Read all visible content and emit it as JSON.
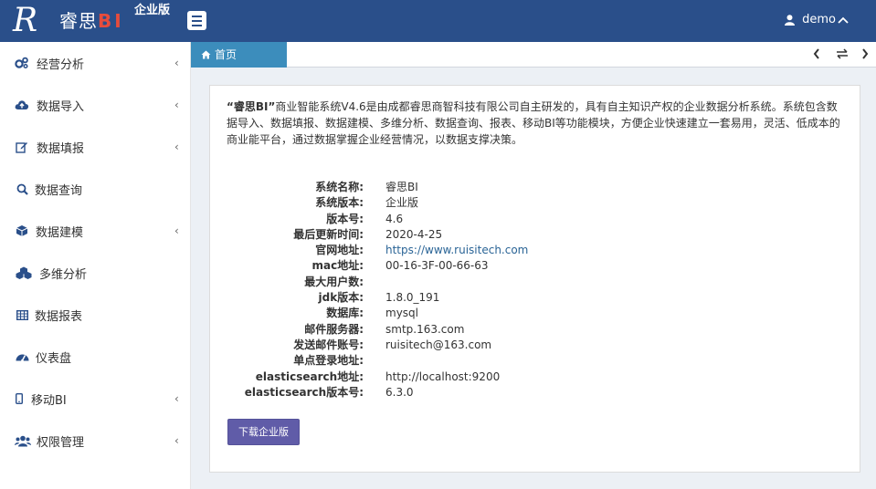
{
  "header": {
    "logo_letter": "R",
    "app_name": "睿思",
    "app_name_bi": "BI",
    "edition": "企业版",
    "user": "demo"
  },
  "sidebar": {
    "items": [
      {
        "label": "经营分析",
        "icon": "cogs-icon",
        "has_arrow": true
      },
      {
        "label": "数据导入",
        "icon": "cloud-upload-icon",
        "has_arrow": true
      },
      {
        "label": "数据填报",
        "icon": "edit-icon",
        "has_arrow": true
      },
      {
        "label": "数据查询",
        "icon": "search-icon",
        "has_arrow": false
      },
      {
        "label": "数据建模",
        "icon": "cube-icon",
        "has_arrow": true
      },
      {
        "label": "多维分析",
        "icon": "cubes-icon",
        "has_arrow": false
      },
      {
        "label": "数据报表",
        "icon": "table-icon",
        "has_arrow": false
      },
      {
        "label": "仪表盘",
        "icon": "dashboard-icon",
        "has_arrow": false
      },
      {
        "label": "移动BI",
        "icon": "mobile-icon",
        "has_arrow": true
      },
      {
        "label": "权限管理",
        "icon": "users-icon",
        "has_arrow": true
      }
    ]
  },
  "tabs": {
    "home_label": "首页"
  },
  "content": {
    "intro_bold": "“睿思BI”",
    "intro_rest": "商业智能系统V4.6是由成都睿思商智科技有限公司自主研发的，具有自主知识产权的企业数据分析系统。系统包含数据导入、数据填报、数据建模、多维分析、数据查询、报表、移动BI等功能模块，方便企业快速建立一套易用，灵活、低成本的商业能平台，通过数据掌握企业经营情况，以数据支撑决策。",
    "info": [
      {
        "key": "系统名称:",
        "value": "睿思BI"
      },
      {
        "key": "系统版本:",
        "value": "企业版"
      },
      {
        "key": "版本号:",
        "value": "4.6"
      },
      {
        "key": "最后更新时间:",
        "value": "2020-4-25"
      },
      {
        "key": "官网地址:",
        "value": "https://www.ruisitech.com"
      },
      {
        "key": "mac地址:",
        "value": "00-16-3F-00-66-63"
      },
      {
        "key": "最大用户数:",
        "value": ""
      },
      {
        "key": "jdk版本:",
        "value": "1.8.0_191"
      },
      {
        "key": "数据库:",
        "value": "mysql"
      },
      {
        "key": "邮件服务器:",
        "value": "smtp.163.com"
      },
      {
        "key": "发送邮件账号:",
        "value": "ruisitech@163.com"
      },
      {
        "key": "单点登录地址:",
        "value": ""
      },
      {
        "key": "elasticsearch地址:",
        "value": "http://localhost:9200"
      },
      {
        "key": "elasticsearch版本号:",
        "value": "6.3.0"
      }
    ],
    "download_label": "下载企业版"
  },
  "colors": {
    "header_bg": "#2a4f8a",
    "tab_active": "#3c8dbc",
    "button": "#605ca8",
    "link": "#2a6496"
  }
}
